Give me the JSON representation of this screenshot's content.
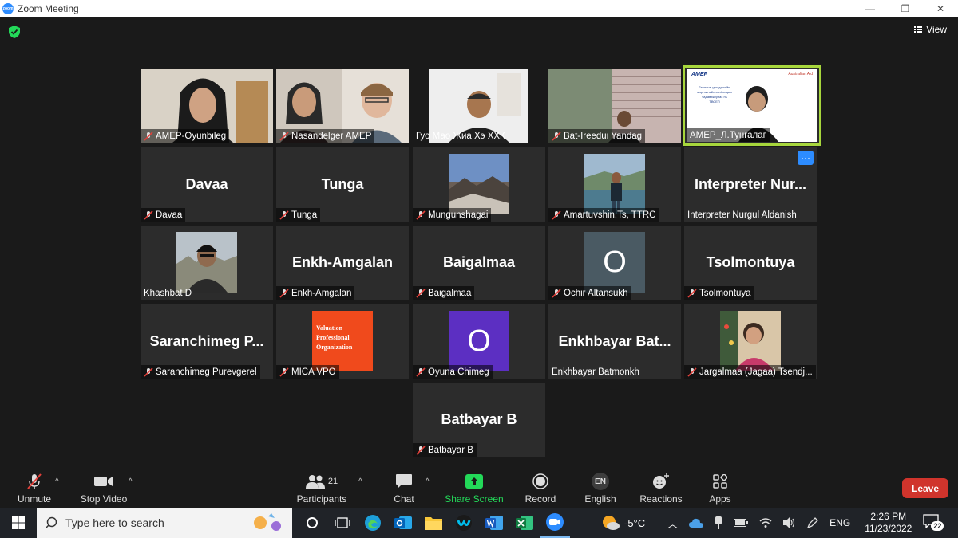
{
  "window": {
    "title": "Zoom Meeting",
    "logo_text": "zoom",
    "minimize": "—",
    "restore": "❐",
    "close": "✕"
  },
  "header": {
    "view_label": "View"
  },
  "participants": [
    {
      "name": "AMEP-Oyunbileg",
      "big": "",
      "type": "video"
    },
    {
      "name": "Nasandelger AMEP",
      "big": "",
      "type": "video"
    },
    {
      "name": "Гуо Мао Жиа Хэ ХХК",
      "big": "",
      "type": "video"
    },
    {
      "name": "Bat-Ireedui Yandag",
      "big": "",
      "type": "video"
    },
    {
      "name": "AMEP_Л.Тунгалаг",
      "big": "",
      "type": "video"
    },
    {
      "name": "Davaa",
      "big": "Davaa",
      "type": "name"
    },
    {
      "name": "Tunga",
      "big": "Tunga",
      "type": "name"
    },
    {
      "name": "Mungunshagai",
      "big": "",
      "type": "photo"
    },
    {
      "name": "Amartuvshin.Ts, TTRC",
      "big": "",
      "type": "photo"
    },
    {
      "name": "Interpreter Nurgul Aldanish",
      "big": "Interpreter  Nur...",
      "type": "name"
    },
    {
      "name": "Khashbat D",
      "big": "",
      "type": "photo"
    },
    {
      "name": "Enkh-Amgalan",
      "big": "Enkh-Amgalan",
      "type": "name"
    },
    {
      "name": "Baigalmaa",
      "big": "Baigalmaa",
      "type": "name"
    },
    {
      "name": "Ochir Altansukh",
      "big": "O",
      "type": "letter"
    },
    {
      "name": "Tsolmontuya",
      "big": "Tsolmontuya",
      "type": "name"
    },
    {
      "name": "Saranchimeg Purevgerel",
      "big": "Saranchimeg  P...",
      "type": "name"
    },
    {
      "name": "MICA VPO",
      "big": "",
      "type": "logo"
    },
    {
      "name": "Oyuna Chimeg",
      "big": "O",
      "type": "letter"
    },
    {
      "name": "Enkhbayar Batmonkh",
      "big": "Enkhbayar  Bat...",
      "type": "name"
    },
    {
      "name": "Jargalmaa (Jagaa) Tsendj...",
      "big": "",
      "type": "photo"
    },
    {
      "name": "Batbayar B",
      "big": "Batbayar B",
      "type": "name"
    }
  ],
  "slide": {
    "brand": "AMEP",
    "partner": "Australian Aid",
    "text1": "Геологи, уул уурхайн",
    "text2": "мэргэжлийн холбоодын",
    "text3": "чадавхжуулах нь",
    "text4": "ТВСЕЛ"
  },
  "vpo_logo": {
    "line1": "Valuation",
    "line2": "Professional",
    "line3": "Organization"
  },
  "toolbar": {
    "unmute": "Unmute",
    "stop_video": "Stop Video",
    "participants": "Participants",
    "participants_count": "21",
    "chat": "Chat",
    "share_screen": "Share Screen",
    "record": "Record",
    "english": "English",
    "en_badge": "EN",
    "reactions": "Reactions",
    "apps": "Apps",
    "leave": "Leave",
    "caret": "^"
  },
  "taskbar": {
    "search_placeholder": "Type here to search",
    "weather": "-5°C",
    "lang": "ENG",
    "time": "2:26 PM",
    "date": "11/23/2022",
    "notifications": "22"
  },
  "colors": {
    "active_speaker": "#a7d63c",
    "share_green": "#23d959",
    "leave_red": "#d0342c",
    "zoom_blue": "#2d8cff"
  }
}
